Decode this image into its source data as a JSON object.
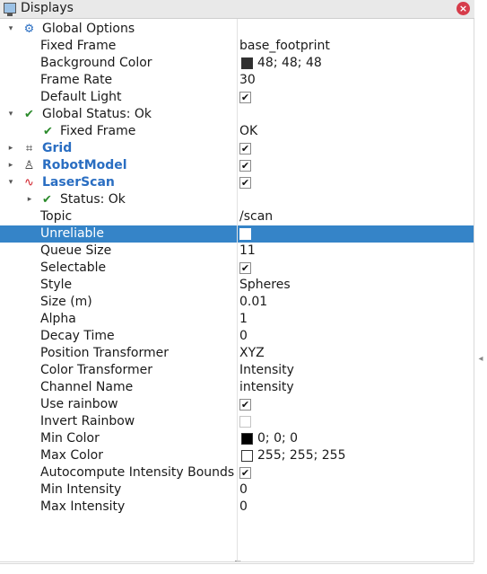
{
  "window": {
    "title": "Displays",
    "close_label": "×"
  },
  "rows": [
    {
      "depth": 0,
      "arrow": "expanded",
      "icon": "gear-icon",
      "glyph": "⚙",
      "name": "Global Options",
      "value": "",
      "kind": "none"
    },
    {
      "depth": 1,
      "name": "Fixed Frame",
      "value": "base_footprint",
      "kind": "text"
    },
    {
      "depth": 1,
      "name": "Background Color",
      "value": "48; 48; 48",
      "kind": "color",
      "color": "#303030"
    },
    {
      "depth": 1,
      "name": "Frame Rate",
      "value": "30",
      "kind": "text"
    },
    {
      "depth": 1,
      "name": "Default Light",
      "checked": true,
      "kind": "checkbox"
    },
    {
      "depth": 0,
      "arrow": "expanded",
      "icon": "check-icon",
      "glyph": "✔",
      "name": "Global Status: Ok",
      "value": "",
      "kind": "none"
    },
    {
      "depth": 1,
      "icon": "check-icon",
      "glyph": "✔",
      "name": "Fixed Frame",
      "value": "OK",
      "kind": "text"
    },
    {
      "depth": 0,
      "arrow": "collapsed",
      "icon": "grid-icon",
      "glyph": "⌗",
      "name": "Grid",
      "checked": true,
      "kind": "checkbox",
      "display": true
    },
    {
      "depth": 0,
      "arrow": "collapsed",
      "icon": "robot-model-icon",
      "glyph": "♙",
      "name": "RobotModel",
      "checked": true,
      "kind": "checkbox",
      "display": true
    },
    {
      "depth": 0,
      "arrow": "expanded",
      "icon": "laser-scan-icon",
      "glyph": "∿",
      "name": "LaserScan",
      "checked": true,
      "kind": "checkbox",
      "display": true
    },
    {
      "depth": 1,
      "arrow": "collapsed",
      "icon": "check-icon",
      "glyph": "✔",
      "name": "Status: Ok",
      "value": "",
      "kind": "none"
    },
    {
      "depth": 1,
      "name": "Topic",
      "value": "/scan",
      "kind": "text"
    },
    {
      "depth": 1,
      "name": "Unreliable",
      "checked": false,
      "kind": "checkbox",
      "selected": true
    },
    {
      "depth": 1,
      "name": "Queue Size",
      "value": "11",
      "kind": "text"
    },
    {
      "depth": 1,
      "name": "Selectable",
      "checked": true,
      "kind": "checkbox"
    },
    {
      "depth": 1,
      "name": "Style",
      "value": "Spheres",
      "kind": "text"
    },
    {
      "depth": 1,
      "name": "Size (m)",
      "value": "0.01",
      "kind": "text"
    },
    {
      "depth": 1,
      "name": "Alpha",
      "value": "1",
      "kind": "text"
    },
    {
      "depth": 1,
      "name": "Decay Time",
      "value": "0",
      "kind": "text"
    },
    {
      "depth": 1,
      "name": "Position Transformer",
      "value": "XYZ",
      "kind": "text"
    },
    {
      "depth": 1,
      "name": "Color Transformer",
      "value": "Intensity",
      "kind": "text"
    },
    {
      "depth": 1,
      "name": "Channel Name",
      "value": "intensity",
      "kind": "text"
    },
    {
      "depth": 1,
      "name": "Use rainbow",
      "checked": true,
      "kind": "checkbox"
    },
    {
      "depth": 1,
      "name": "Invert Rainbow",
      "checked": false,
      "kind": "checkbox"
    },
    {
      "depth": 1,
      "name": "Min Color",
      "value": "0; 0; 0",
      "kind": "color",
      "color": "#000000"
    },
    {
      "depth": 1,
      "name": "Max Color",
      "value": "255; 255; 255",
      "kind": "color",
      "color": "#ffffff"
    },
    {
      "depth": 1,
      "name": "Autocompute Intensity Bounds",
      "checked": true,
      "kind": "checkbox"
    },
    {
      "depth": 1,
      "name": "Min Intensity",
      "value": "0",
      "kind": "text"
    },
    {
      "depth": 1,
      "name": "Max Intensity",
      "value": "0",
      "kind": "text"
    }
  ],
  "colors": {
    "selection": "#3584c8",
    "display_name": "#2a6ec2",
    "status_ok": "#2a8a2a"
  }
}
